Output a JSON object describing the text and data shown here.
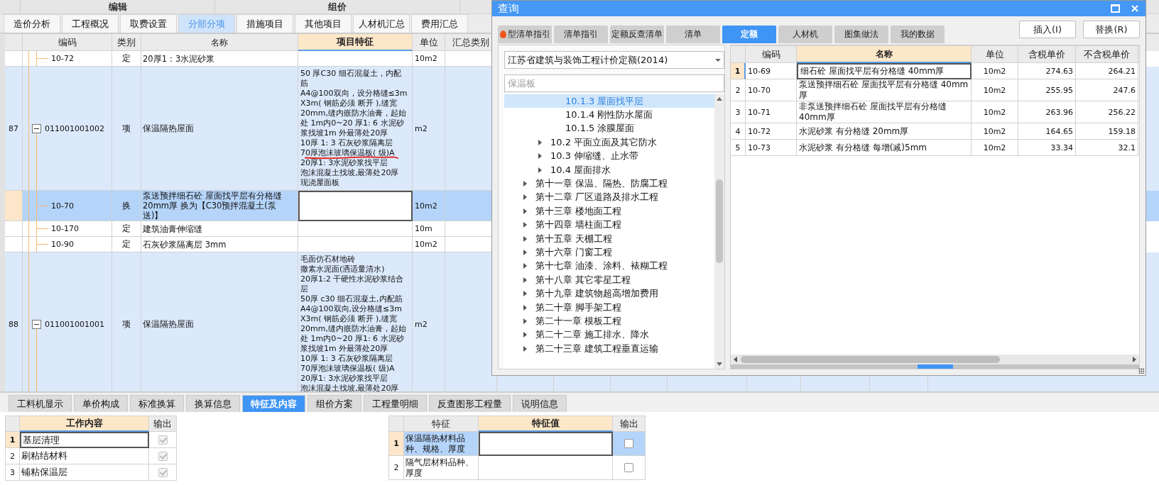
{
  "top_groups": [
    "编辑",
    "组价"
  ],
  "main_tabs": [
    {
      "label": "造价分析",
      "selected": false
    },
    {
      "label": "工程概况",
      "selected": false
    },
    {
      "label": "取费设置",
      "selected": false
    },
    {
      "label": "分部分项",
      "selected": true
    },
    {
      "label": "措施项目",
      "selected": false
    },
    {
      "label": "其他项目",
      "selected": false
    },
    {
      "label": "人材机汇总",
      "selected": false
    },
    {
      "label": "费用汇总",
      "selected": false
    }
  ],
  "grid": {
    "columns": [
      {
        "label": "编码",
        "active": false
      },
      {
        "label": "类别",
        "active": false
      },
      {
        "label": "名称",
        "active": false
      },
      {
        "label": "项目特征",
        "active": true
      },
      {
        "label": "单位",
        "active": false
      },
      {
        "label": "汇总类别",
        "active": false
      }
    ],
    "rows": [
      {
        "children": [
          {
            "code": "10-72",
            "type": "定",
            "name": "20厚1：3水泥砂浆",
            "unit": "10m2",
            "kind": "quota",
            "selected": false
          }
        ]
      },
      {
        "no": "87",
        "code": "011001001002",
        "type": "项",
        "name": "保温隔热屋面",
        "unit": "m2",
        "kind": "item",
        "selected": false,
        "expanded": true,
        "feature": [
          "50 厚C30 细石混凝土，内配",
          "筋",
          "A4@100双向，设分格缝≤3m",
          "X3m( 钢筋必须 断开 ),缝宽",
          "20mm,缝内嵌防水油膏，起始",
          "处 1m内0~20 厚1: 6 水泥砂",
          "浆找坡1m 外最薄处20厚",
          "10厚 1: 3 石灰砂浆隔离层",
          "70厚泡沫玻璃保温板( 级)A",
          "20厚1: 3水泥砂浆找平层",
          "泡沫混凝土找坡,最薄处20厚",
          "现浇屋面板"
        ],
        "children": [
          {
            "code": "10-70",
            "type": "换",
            "name": "泵送预拌细石砼 屋面找平层有分格缝 20mm厚  换为【C30预拌混凝土(泵送)】",
            "unit": "10m2",
            "kind": "quota",
            "selected": true
          },
          {
            "code": "10-170",
            "type": "定",
            "name": "建筑油膏伸缩缝",
            "unit": "10m",
            "kind": "quota",
            "selected": false
          },
          {
            "code": "10-90",
            "type": "定",
            "name": "石灰砂浆隔离层 3mm",
            "unit": "10m2",
            "kind": "quota",
            "selected": false
          }
        ]
      },
      {
        "no": "88",
        "code": "011001001001",
        "type": "项",
        "name": "保温隔热屋面",
        "unit": "m2",
        "kind": "item",
        "selected": false,
        "expanded": true,
        "feature": [
          "毛面仿石材地砖",
          "撒素水泥面(洒适量清水)",
          "20厚1:2 干硬性水泥砂浆结合",
          "层",
          "50厚 c30 细石混凝土,内配筋",
          "A4@100双向,设分格缝≤3m",
          "X3m( 钢筋必须 断开 ),缝宽",
          "20mm,缝内嵌防水油膏，起始",
          "处 1m内0~20 厚1: 6 水泥砂",
          "浆找坡1m 外最薄处20厚",
          "10厚 1: 3 石灰砂浆隔离层",
          "70厚泡沫玻璃保温板( 级)A",
          "20厚1: 3水泥砂浆找平层",
          "泡沫混凝土找坡,最薄处20厚"
        ]
      }
    ]
  },
  "dialog": {
    "title": "查询",
    "tabs": [
      {
        "label": "型清单指引",
        "kind": "hot",
        "selected": false
      },
      {
        "label": "清单指引",
        "kind": "plain",
        "selected": false
      },
      {
        "label": "定额反查清单",
        "kind": "plain",
        "selected": false
      },
      {
        "label": "清单",
        "kind": "plain",
        "selected": false
      },
      {
        "label": "定额",
        "kind": "plain",
        "selected": true
      },
      {
        "label": "人材机",
        "kind": "plain",
        "selected": false
      },
      {
        "label": "图集做法",
        "kind": "plain",
        "selected": false
      },
      {
        "label": "我的数据",
        "kind": "plain",
        "selected": false
      }
    ],
    "buttons": [
      "插入(I)",
      "替换(R)"
    ],
    "library": "江苏省建筑与装饰工程计价定额(2014)",
    "search": {
      "placeholder": "保温板"
    },
    "tree": [
      {
        "children": [
          {
            "children": [
              {
                "label": "10.1.3 屋面找平层",
                "selected": true
              },
              {
                "label": "10.1.4 刚性防水屋面",
                "selected": false
              },
              {
                "label": "10.1.5 涂膜屋面",
                "selected": false
              }
            ]
          },
          {
            "label": "10.2 平面立面及其它防水",
            "expanded": false,
            "selected": false
          },
          {
            "label": "10.3 伸缩缝、止水带",
            "expanded": false,
            "selected": false
          },
          {
            "label": "10.4 屋面排水",
            "expanded": false,
            "selected": false
          }
        ]
      },
      {
        "label": "第十一章 保温、隔热、防腐工程",
        "expanded": false,
        "selected": false
      },
      {
        "label": "第十二章 厂区道路及排水工程",
        "expanded": false,
        "selected": false
      },
      {
        "label": "第十三章 楼地面工程",
        "expanded": false,
        "selected": false
      },
      {
        "label": "第十四章 墙柱面工程",
        "expanded": false,
        "selected": false
      },
      {
        "label": "第十五章 天棚工程",
        "expanded": false,
        "selected": false
      },
      {
        "label": "第十六章 门窗工程",
        "expanded": false,
        "selected": false
      },
      {
        "label": "第十七章 油漆、涂料、裱糊工程",
        "expanded": false,
        "selected": false
      },
      {
        "label": "第十八章 其它零星工程",
        "expanded": false,
        "selected": false
      },
      {
        "label": "第十九章 建筑物超高增加费用",
        "expanded": false,
        "selected": false
      },
      {
        "label": "第二十章 脚手架工程",
        "expanded": false,
        "selected": false
      },
      {
        "label": "第二十一章 模板工程",
        "expanded": false,
        "selected": false
      },
      {
        "label": "第二十二章 施工排水、降水",
        "expanded": false,
        "selected": false
      },
      {
        "label": "第二十三章 建筑工程垂直运输",
        "expanded": false,
        "selected": false
      }
    ],
    "table": {
      "columns": [
        {
          "label": "编码",
          "active": false
        },
        {
          "label": "名称",
          "active": true
        },
        {
          "label": "单位",
          "active": false
        },
        {
          "label": "含税单价",
          "active": false
        },
        {
          "label": "不含税单价",
          "active": false
        }
      ],
      "rows": [
        {
          "no": "1",
          "code": "10-69",
          "name": "细石砼 屋面找平层有分格缝 40mm厚",
          "unit": "10m2",
          "price_tax": "274.63",
          "price_notax": "264.21",
          "selected": true
        },
        {
          "no": "2",
          "code": "10-70",
          "name": "泵送预拌细石砼 屋面找平层有分格缝 40mm厚",
          "unit": "10m2",
          "price_tax": "255.95",
          "price_notax": "247.6",
          "selected": false
        },
        {
          "no": "3",
          "code": "10-71",
          "name": "非泵送预拌细石砼 屋面找平层有分格缝 40mm厚",
          "unit": "10m2",
          "price_tax": "263.96",
          "price_notax": "256.22",
          "selected": false
        },
        {
          "no": "4",
          "code": "10-72",
          "name": "水泥砂浆 有分格缝 20mm厚",
          "unit": "10m2",
          "price_tax": "164.65",
          "price_notax": "159.18",
          "selected": false
        },
        {
          "no": "5",
          "code": "10-73",
          "name": "水泥砂浆 有分格缝 每增(减)5mm",
          "unit": "10m2",
          "price_tax": "33.34",
          "price_notax": "32.1",
          "selected": false
        }
      ]
    }
  },
  "bottom_tabs": [
    {
      "label": "工料机显示",
      "selected": false
    },
    {
      "label": "单价构成",
      "selected": false
    },
    {
      "label": "标准换算",
      "selected": false
    },
    {
      "label": "换算信息",
      "selected": false
    },
    {
      "label": "特征及内容",
      "selected": true
    },
    {
      "label": "组价方案",
      "selected": false
    },
    {
      "label": "工程量明细",
      "selected": false
    },
    {
      "label": "反查图形工程量",
      "selected": false
    },
    {
      "label": "说明信息",
      "selected": false
    }
  ],
  "work_table": {
    "columns": [
      {
        "label": "工作内容",
        "active": true
      },
      {
        "label": "输出",
        "active": false
      }
    ],
    "rows": [
      {
        "no": "1",
        "content": "基层清理",
        "output": true,
        "disabled": true,
        "selected": true
      },
      {
        "no": "2",
        "content": "刷粘结材料",
        "output": true,
        "disabled": true,
        "selected": false
      },
      {
        "no": "3",
        "content": "铺粘保温层",
        "output": true,
        "disabled": true,
        "selected": false
      }
    ]
  },
  "feature_table": {
    "columns": [
      {
        "label": "特征",
        "active": false
      },
      {
        "label": "特征值",
        "active": true
      },
      {
        "label": "输出",
        "active": false
      }
    ],
    "rows": [
      {
        "no": "1",
        "feature": "保温隔热材料品种、规格、厚度",
        "output": false,
        "selected": true
      },
      {
        "no": "2",
        "feature": "隔气层材料品种、厚度",
        "output": false,
        "selected": false
      }
    ]
  }
}
